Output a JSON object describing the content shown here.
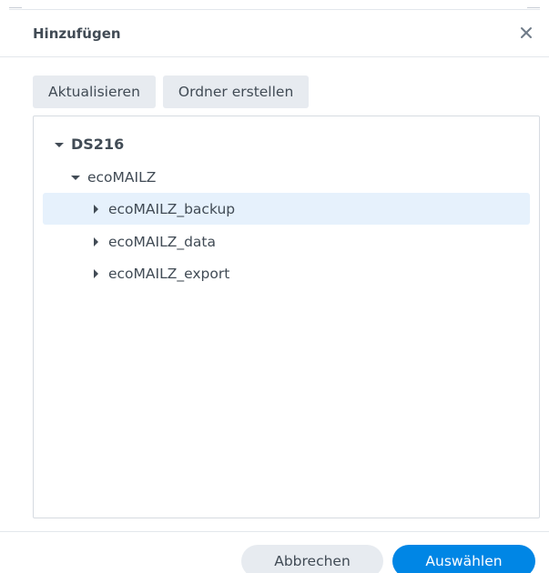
{
  "dialog": {
    "title": "Hinzufügen",
    "close_icon": "close-icon"
  },
  "toolbar": {
    "refresh_label": "Aktualisieren",
    "create_folder_label": "Ordner erstellen"
  },
  "tree": {
    "root": {
      "label": "DS216",
      "expanded": true
    },
    "folder": {
      "label": "ecoMAILZ",
      "expanded": true
    },
    "children": [
      {
        "label": "ecoMAILZ_backup",
        "expanded": false,
        "selected": true
      },
      {
        "label": "ecoMAILZ_data",
        "expanded": false,
        "selected": false
      },
      {
        "label": "ecoMAILZ_export",
        "expanded": false,
        "selected": false
      }
    ]
  },
  "footer": {
    "cancel_label": "Abbrechen",
    "select_label": "Auswählen"
  },
  "colors": {
    "primary": "#0086e5",
    "selection": "#e6f1fc",
    "button_bg": "#e7ebf0",
    "text": "#414b55"
  }
}
